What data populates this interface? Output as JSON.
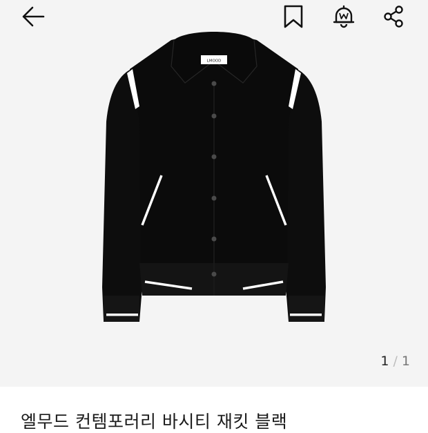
{
  "gallery": {
    "current_page": "1",
    "separator": "/",
    "total_pages": "1"
  },
  "product": {
    "title": "엘무드 컨템포러리 바시티 재킷 블랙",
    "label_text": "LMOOD"
  },
  "icons": {
    "back": "arrow-left-icon",
    "bookmark": "bookmark-icon",
    "notification": "bell-icon",
    "share": "share-icon"
  },
  "colors": {
    "hero_background": "#f4f4f4",
    "jacket": "#0c0c0c",
    "trim": "#ffffff"
  }
}
